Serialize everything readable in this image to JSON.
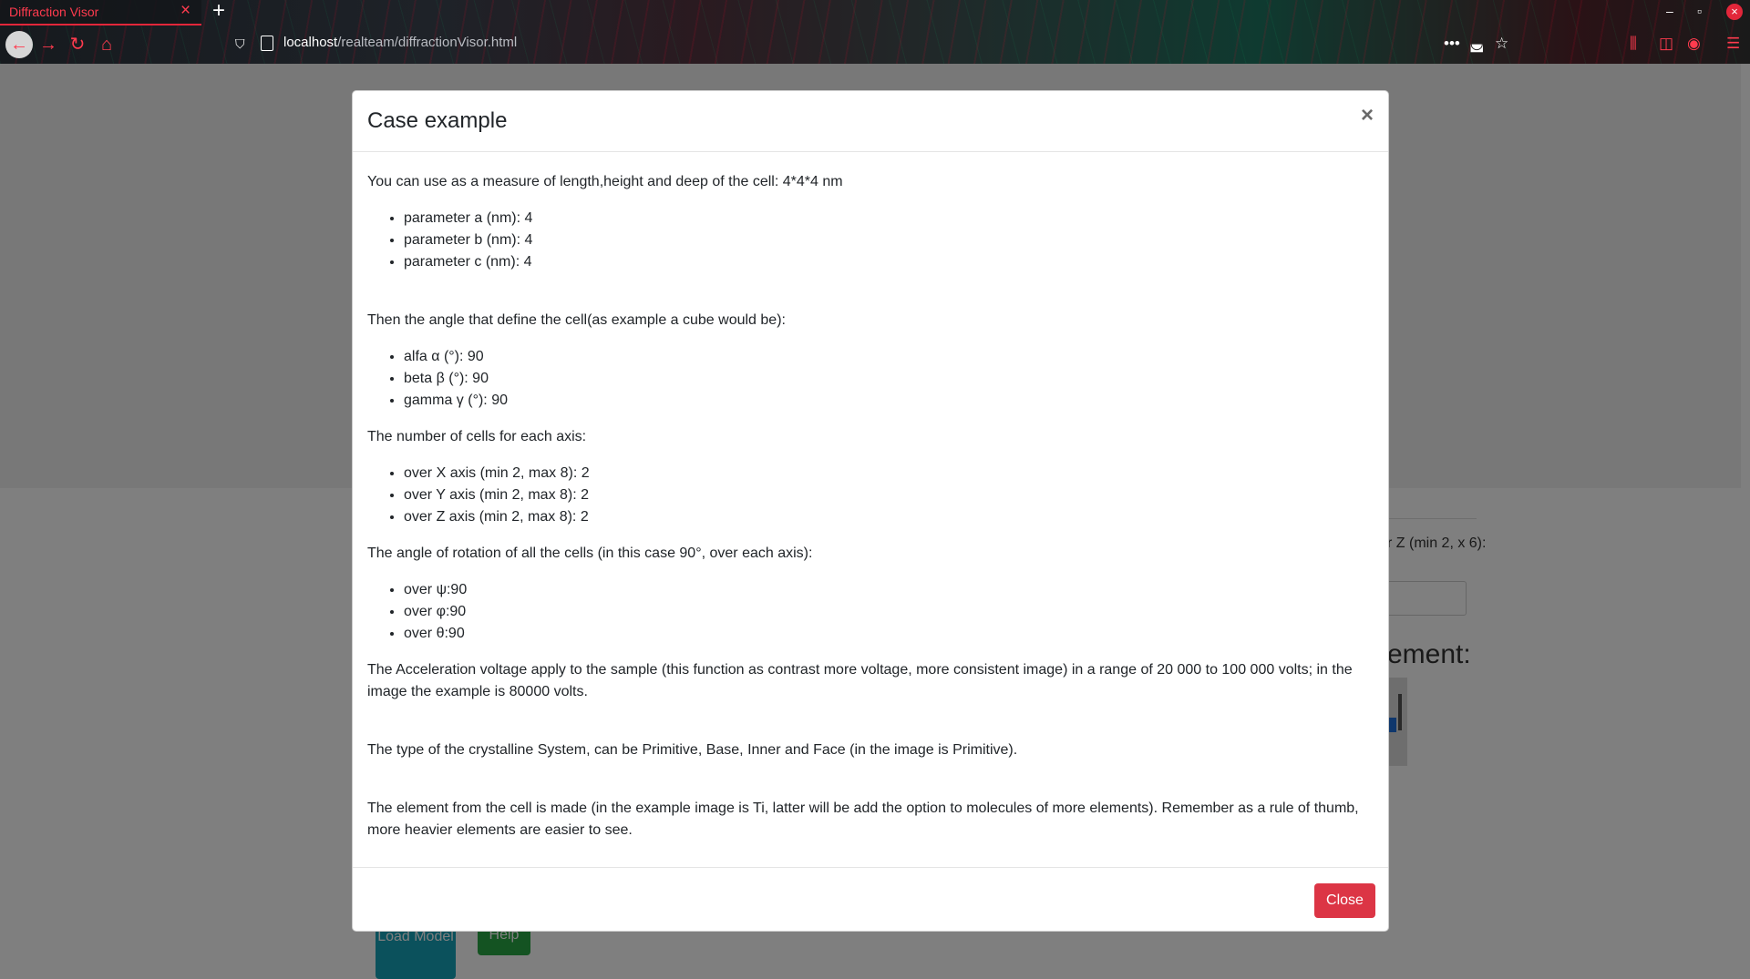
{
  "browser": {
    "tab_title": "Diffraction Visor",
    "tab_close": "×",
    "new_tab": "+",
    "url_host": "localhost",
    "url_path": "/realteam/diffractionVisor.html",
    "win_minimize": "–",
    "win_maximize": "▫",
    "win_close": "×"
  },
  "page": {
    "partial_text": "r Z (min 2, x 6):",
    "partial_heading": "ement:",
    "load_model_label": "Load Model",
    "help_label": "Help"
  },
  "modal": {
    "title": "Case example",
    "close_x": "×",
    "intro": "You can use as a measure of length,height and deep of the cell: 4*4*4 nm",
    "params": [
      "parameter a (nm): 4",
      "parameter b (nm): 4",
      "parameter c (nm): 4"
    ],
    "angles_intro": "Then the angle that define the cell(as example a cube would be):",
    "angles": [
      "alfa α (°): 90",
      "beta β (°): 90",
      "gamma γ (°): 90"
    ],
    "cells_intro": "The number of cells for each axis:",
    "cells": [
      "over X axis (min 2, max 8): 2",
      "over Y axis (min 2, max 8): 2",
      "over Z axis (min 2, max 8): 2"
    ],
    "rotation_intro": "The angle of rotation of all the cells (in this case 90°, over each axis):",
    "rotations": [
      "over ψ:90",
      "over φ:90",
      "over θ:90"
    ],
    "voltage_text": "The Acceleration voltage apply to the sample (this function as contrast more voltage, more consistent image) in a range of 20 000 to 100 000 volts; in the image the example is 80000 volts.",
    "system_text": "The type of the crystalline System, can be Primitive, Base, Inner and Face (in the image is Primitive).",
    "element_text": "The element from the cell is made (in the example image is Ti, latter will be add the option to molecules of more elements). Remember as a rule of thumb, more heavier elements are easier to see.",
    "close_button_label": "Close"
  }
}
